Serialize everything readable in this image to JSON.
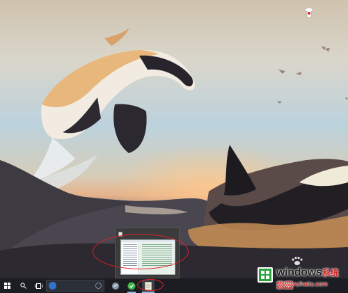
{
  "desktop": {
    "wallpaper_icon": "orca-wallpaper",
    "desktop_icon": "shirt-icon"
  },
  "taskbar": {
    "start_icon": "windows-logo-icon",
    "search_icon": "search-icon",
    "task_view_icon": "task-view-icon",
    "search_placeholder": "",
    "apps": [
      {
        "icon": "app-icon-1"
      },
      {
        "icon": "app-icon-2"
      },
      {
        "icon": "notepad-icon"
      }
    ]
  },
  "thumbnail": {
    "title": ""
  },
  "watermark": {
    "brand_main": "windows",
    "brand_tail": "系统家园",
    "url": "www.ruihaitu.com"
  },
  "colors": {
    "annotation": "#e0202a",
    "taskbar": "#1b1d22",
    "accent": "#2aa53b"
  }
}
